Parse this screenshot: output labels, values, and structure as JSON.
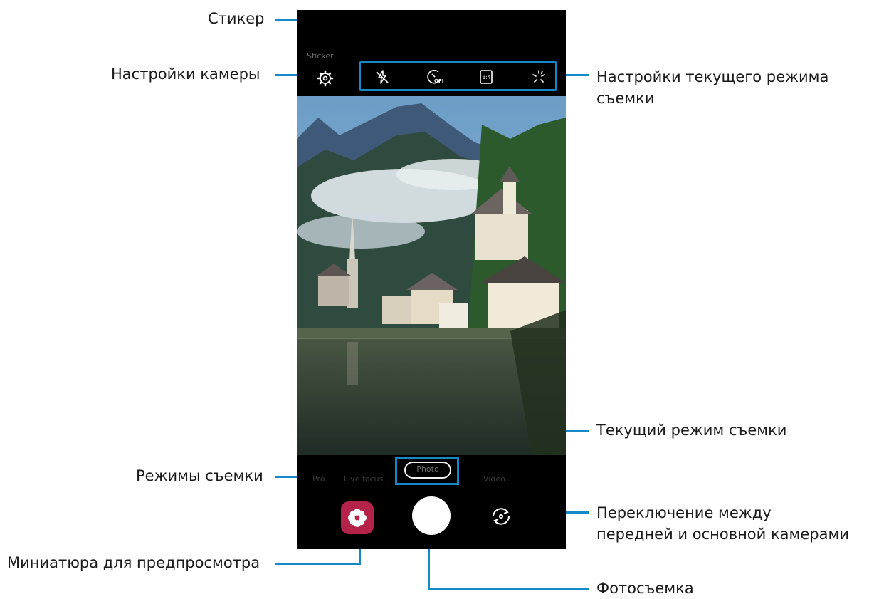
{
  "callouts": {
    "sticker": "Стикер",
    "camera_settings": "Настройки камеры",
    "current_mode_settings": "Настройки текущего режима съемки",
    "current_mode": "Текущий режим съемки",
    "shooting_modes": "Режимы съемки",
    "switch_camera": "Переключение между передней и основной камерами",
    "preview_thumbnail": "Миниатюра для предпросмотра",
    "take_photo": "Фотосъемка"
  },
  "camera": {
    "sticker_label": "Sticker",
    "mode_settings_icons": [
      "flash-off-icon",
      "timer-off-icon",
      "ratio-3-4-icon",
      "effects-icon"
    ],
    "timer_label": "OFF",
    "ratio_label": "3:4",
    "modes": [
      "Pro",
      "Live focus",
      "Photo",
      "Video"
    ],
    "current_mode": "Photo"
  },
  "colors": {
    "accent": "#1589c8",
    "thumbnail": "#b6234a"
  }
}
